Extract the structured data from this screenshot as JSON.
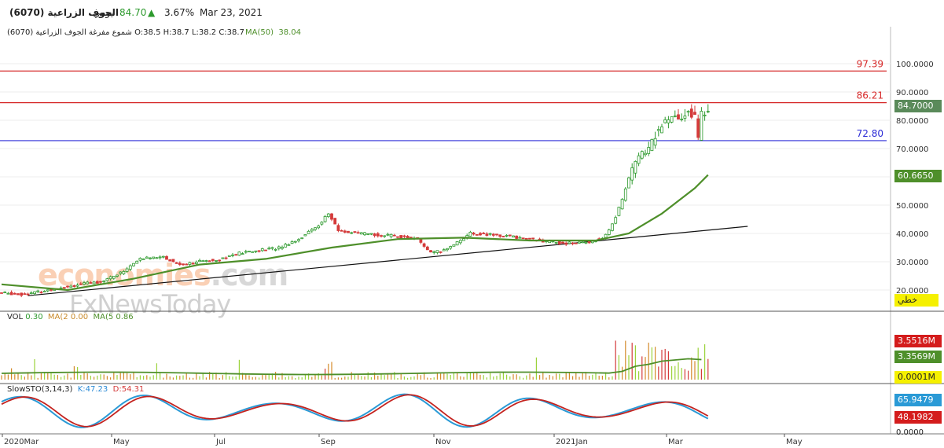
{
  "header": {
    "symbol_name": "الجوف الزراعية (6070)",
    "period": "يومي",
    "last": "84.70",
    "change_pct": "3.67%",
    "date": "Mar 23, 2021"
  },
  "ohlc_line": {
    "text": "الجوف الزراعية (6070) O:38.5 H:38.7 L:38.2 C:38.7",
    "sub_label": "شموع مفرغة",
    "ma_label": "MA(50)",
    "ma_value": "38.04"
  },
  "watermark": {
    "brand": "economies",
    "brand_suffix": ".com",
    "partner": "FxNewsToday"
  },
  "colors": {
    "up": "#2e9a2e",
    "down": "#d43a3a",
    "ma": "#4e8f2a",
    "hline_red": "#d62828",
    "hline_blue": "#2a2ad6",
    "trend": "#111111"
  },
  "chart_data": [
    {
      "type": "line",
      "title": "",
      "x_ticks": [
        "2020Mar",
        "May",
        "Jul",
        "Sep",
        "Nov",
        "2021Jan",
        "Mar",
        "May"
      ],
      "y_ticks": [
        "20.0000",
        "30.0000",
        "40.0000",
        "50.0000",
        "60.0000",
        "70.0000",
        "80.0000",
        "90.0000",
        "100.0000"
      ],
      "ylim": [
        14,
        110
      ],
      "close_points": [
        [
          0,
          19
        ],
        [
          6,
          18.5
        ],
        [
          12,
          19.5
        ],
        [
          18,
          21
        ],
        [
          24,
          22
        ],
        [
          30,
          23
        ],
        [
          36,
          26
        ],
        [
          42,
          31
        ],
        [
          48,
          32
        ],
        [
          54,
          29
        ],
        [
          60,
          30
        ],
        [
          66,
          31
        ],
        [
          72,
          33
        ],
        [
          78,
          34
        ],
        [
          84,
          35
        ],
        [
          90,
          38
        ],
        [
          96,
          43
        ],
        [
          99,
          47
        ],
        [
          102,
          41
        ],
        [
          108,
          40
        ],
        [
          114,
          39.5
        ],
        [
          120,
          39
        ],
        [
          126,
          38
        ],
        [
          130,
          33
        ],
        [
          134,
          34
        ],
        [
          138,
          37
        ],
        [
          142,
          40
        ],
        [
          148,
          39.5
        ],
        [
          154,
          39
        ],
        [
          160,
          38
        ],
        [
          166,
          37
        ],
        [
          172,
          36.5
        ],
        [
          178,
          37
        ],
        [
          182,
          38.5
        ],
        [
          184,
          41
        ],
        [
          186,
          46
        ],
        [
          188,
          52
        ],
        [
          190,
          60
        ],
        [
          192,
          65
        ],
        [
          194,
          68
        ],
        [
          196,
          70
        ],
        [
          198,
          75
        ],
        [
          200,
          78
        ],
        [
          202,
          80
        ],
        [
          204,
          81
        ],
        [
          206,
          80
        ],
        [
          208,
          84
        ],
        [
          210,
          81
        ],
        [
          211,
          73
        ],
        [
          212,
          82
        ],
        [
          214,
          84.7
        ]
      ],
      "series": [
        {
          "name": "MA(50)",
          "values": [
            [
              0,
              22
            ],
            [
              20,
              20
            ],
            [
              40,
              24
            ],
            [
              60,
              29
            ],
            [
              80,
              31
            ],
            [
              100,
              35
            ],
            [
              120,
              38
            ],
            [
              140,
              38.5
            ],
            [
              160,
              37.5
            ],
            [
              180,
              37.5
            ],
            [
              190,
              40
            ],
            [
              200,
              47
            ],
            [
              210,
              56
            ],
            [
              214,
              60.67
            ]
          ]
        }
      ],
      "trendline": [
        [
          8,
          18
        ],
        [
          226,
          42.5
        ]
      ],
      "horizontal_lines": [
        {
          "label": "97.39",
          "value": 97.39,
          "color": "red"
        },
        {
          "label": "86.21",
          "value": 86.21,
          "color": "red"
        },
        {
          "label": "72.80",
          "value": 72.8,
          "color": "blue"
        }
      ],
      "price_labels": [
        {
          "label": "84.7000",
          "value": 84.7
        },
        {
          "label": "60.6650",
          "value": 60.665
        }
      ],
      "scale_badge": "خطي"
    },
    {
      "type": "bar",
      "title": "VOL",
      "legend": [
        {
          "name": "VOL",
          "value": "0.30"
        },
        {
          "name": "MA(2",
          "value": "0.00"
        },
        {
          "name": "MA(5",
          "value": "0.86"
        }
      ],
      "price_labels": [
        {
          "label": "3.5516M",
          "color": "red"
        },
        {
          "label": "3.3569M",
          "color": "green"
        },
        {
          "label": "0.0001M",
          "color": "yellow"
        }
      ]
    },
    {
      "type": "line",
      "title": "SlowSTO(3,14,3)",
      "legend": [
        {
          "name": "K",
          "value": "47.23"
        },
        {
          "name": "D",
          "value": "54.31"
        }
      ],
      "y_ticks": [
        "0.0000",
        "65.9479"
      ],
      "ylim": [
        0,
        100
      ],
      "price_labels": [
        {
          "label": "65.9479",
          "color": "blue"
        },
        {
          "label": "48.1982",
          "color": "red"
        }
      ]
    }
  ]
}
